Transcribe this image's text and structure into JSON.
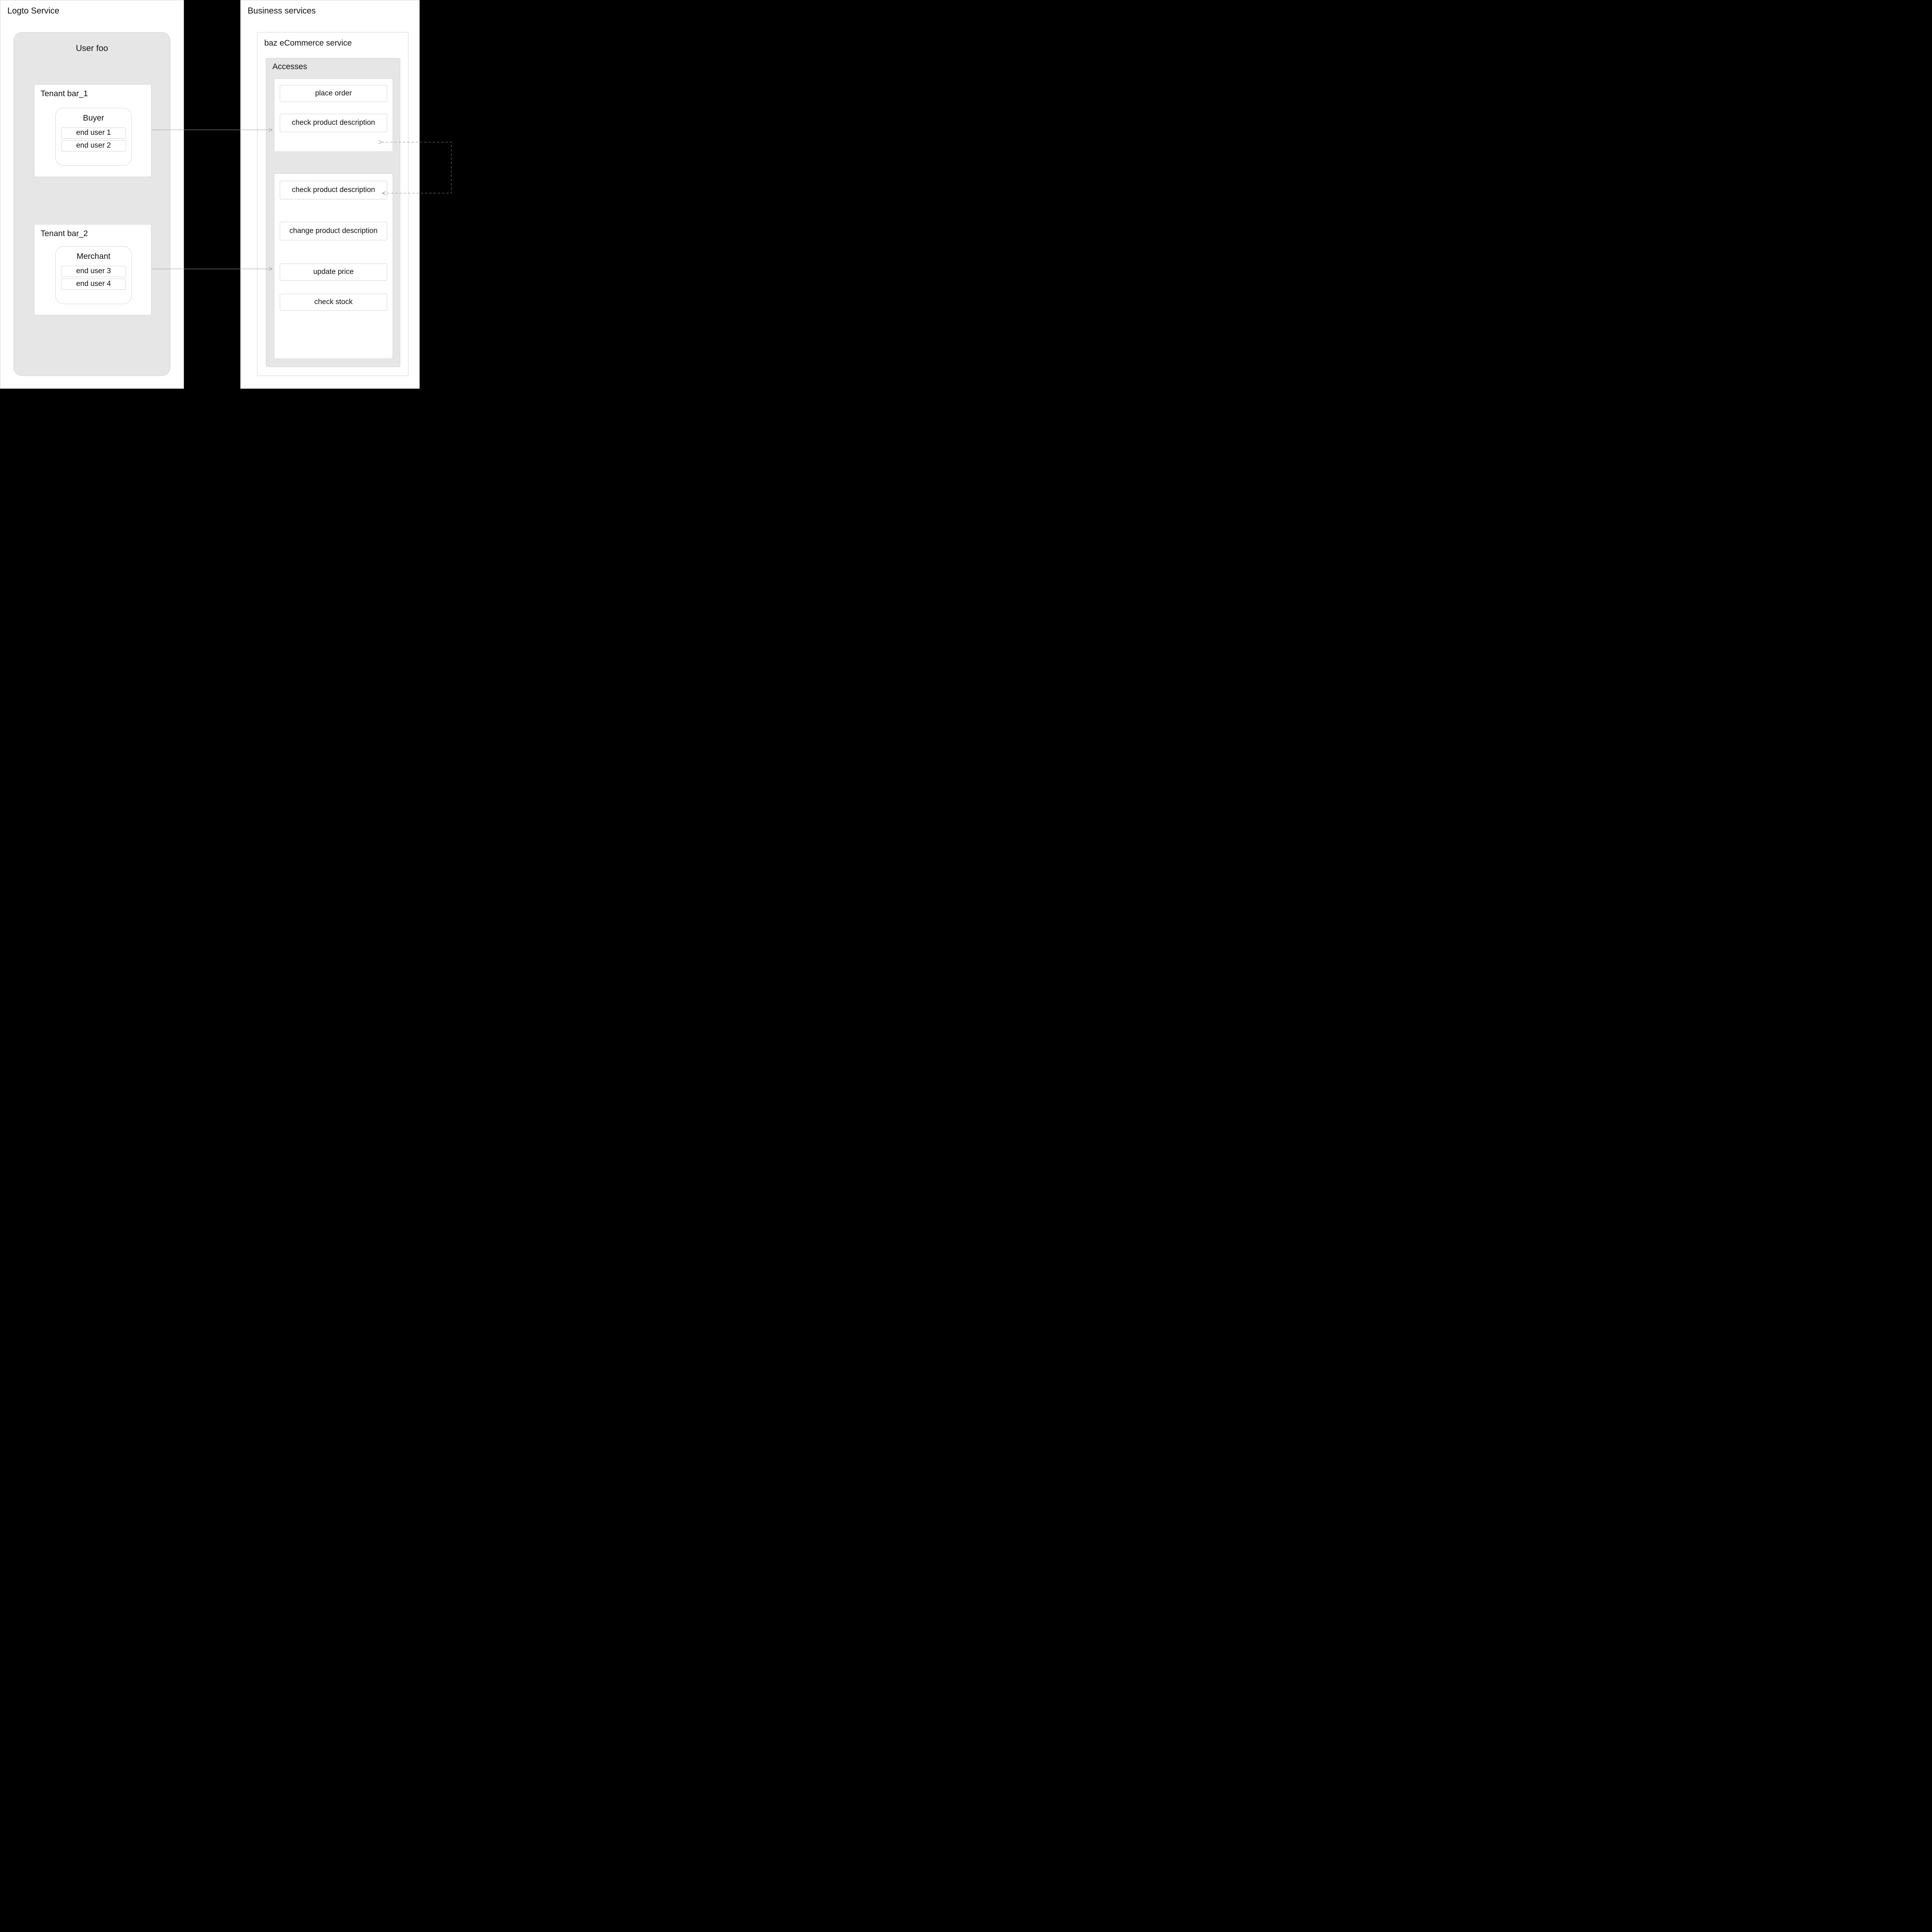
{
  "left": {
    "title": "Logto Service",
    "user_box_title": "User foo",
    "tenants": [
      {
        "title": "Tenant bar_1",
        "role": {
          "title": "Buyer",
          "users": [
            "end user 1",
            "end user 2"
          ]
        }
      },
      {
        "title": "Tenant bar_2",
        "role": {
          "title": "Merchant",
          "users": [
            "end user 3",
            "end user 4"
          ]
        }
      }
    ]
  },
  "right": {
    "title": "Business services",
    "service": {
      "title": "baz eCommerce service",
      "accesses_title": "Accesses",
      "groups": [
        {
          "items": [
            {
              "label": "place order",
              "dashed": false
            },
            {
              "label": "check product description",
              "dashed": false
            }
          ]
        },
        {
          "items": [
            {
              "label": "check product description",
              "dashed": true
            },
            {
              "label": "change product description",
              "dashed": false
            },
            {
              "label": "update price",
              "dashed": false
            },
            {
              "label": "check stock",
              "dashed": false
            }
          ]
        }
      ]
    }
  }
}
